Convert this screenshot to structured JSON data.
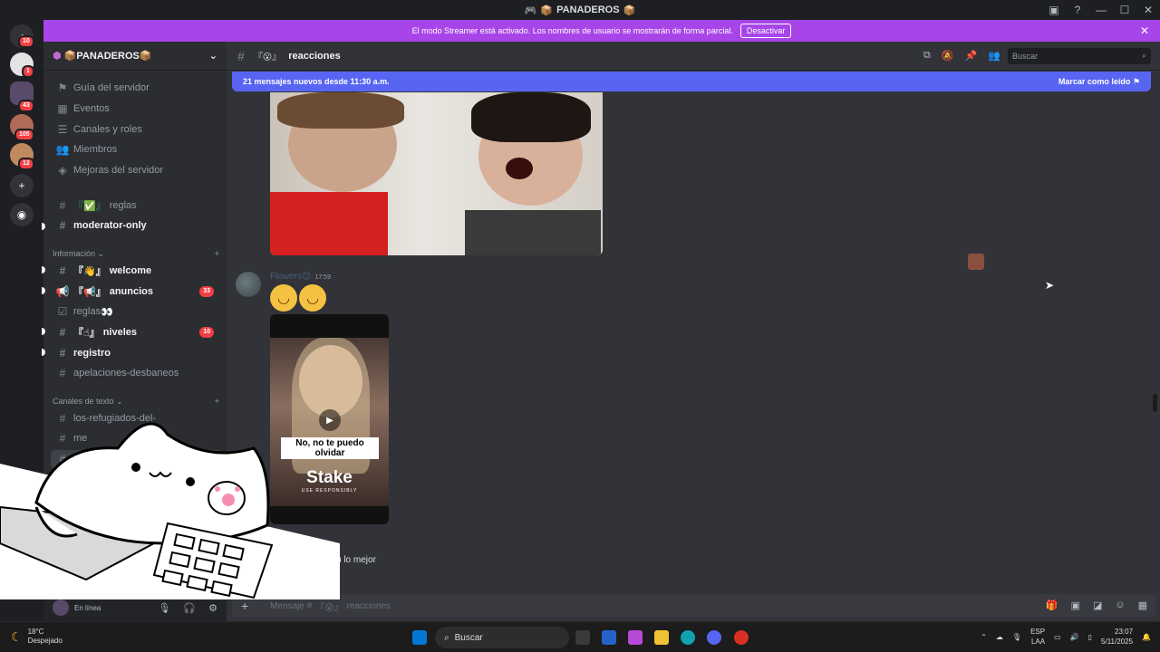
{
  "titlebar": {
    "title": "PANADEROS"
  },
  "guilds": {
    "badges": [
      "10",
      "1",
      "43",
      "105",
      "12"
    ]
  },
  "streamer_banner": {
    "text": "El modo Streamer está activado. Los nombres de usuario se mostrarán de forma parcial.",
    "button": "Desactivar"
  },
  "server": {
    "name": "PANADEROS"
  },
  "sidebar": {
    "menu": [
      "Guía del servidor",
      "Eventos",
      "Canales y roles",
      "Miembros",
      "Mejoras del servidor"
    ],
    "channels_top": [
      {
        "label": "reglas"
      },
      {
        "label": "moderator-only"
      }
    ],
    "cat_info": "Información",
    "info_channels": [
      {
        "label": "welcome",
        "count": ""
      },
      {
        "label": "anuncios",
        "count": "33"
      },
      {
        "label": "reglas",
        "count": ""
      },
      {
        "label": "niveles",
        "count": "10"
      },
      {
        "label": "registro",
        "count": ""
      },
      {
        "label": "apelaciones-desbaneos",
        "count": ""
      }
    ],
    "cat_text": "Canales de texto",
    "text_channels": [
      "los-refugiados-del-",
      "me",
      "",
      "z"
    ]
  },
  "user": {
    "status": "En línea"
  },
  "header": {
    "channel": "reacciones",
    "search_placeholder": "Buscar"
  },
  "new_messages": {
    "text": "21 mensajes nuevos desde 11:30 a.m.",
    "action": "Marcar como leído"
  },
  "message": {
    "author": "Flowers",
    "time": "17:59",
    "video_caption": "No, no te puedo olvidar",
    "video_brand": "Stake",
    "video_sub": "USE RESPONSIBLY"
  },
  "next_message_fragment": "zu lo mejor",
  "composer": {
    "placeholder": "Mensaje #",
    "channel": "reacciones"
  },
  "taskbar": {
    "weather": {
      "temp": "18°C",
      "desc": "Despejado"
    },
    "search": "Buscar",
    "lang": "ESP",
    "layout": "LAA",
    "time": "23:07",
    "date": "5/11/2025"
  }
}
